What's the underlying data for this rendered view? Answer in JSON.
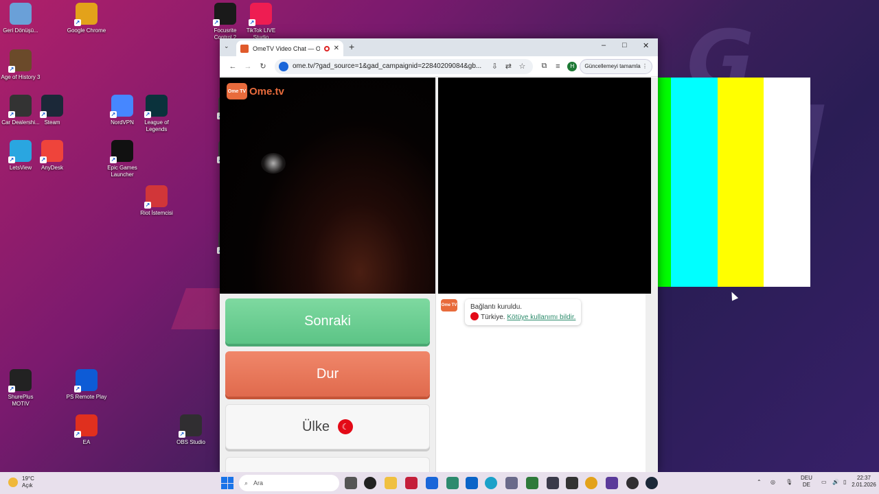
{
  "desktop": {
    "icons": [
      {
        "label": "Geri Dönüşü...",
        "icon": "recycle-bin-icon",
        "color": "#6aa0d8"
      },
      {
        "label": "Google Chrome",
        "icon": "chrome-icon",
        "color": "#e3a21a"
      },
      {
        "label": "Focusrite Control 2",
        "icon": "focusrite-icon",
        "color": "#1a1a1a"
      },
      {
        "label": "TikTok LIVE Studio",
        "icon": "tiktok-icon",
        "color": "#ee1d52"
      },
      {
        "label": "Age of History 3",
        "icon": "age-of-history-icon",
        "color": "#6b4a2a"
      },
      {
        "label": "Car Dealershi...",
        "icon": "car-dealership-icon",
        "color": "#333333"
      },
      {
        "label": "Steam",
        "icon": "steam-icon",
        "color": "#1b2838"
      },
      {
        "label": "NordVPN",
        "icon": "nordvpn-icon",
        "color": "#4687ff"
      },
      {
        "label": "League of Legends",
        "icon": "league-of-legends-icon",
        "color": "#0a323c"
      },
      {
        "label": "LetsView",
        "icon": "letsview-icon",
        "color": "#2aa6e0"
      },
      {
        "label": "AnyDesk",
        "icon": "anydesk-icon",
        "color": "#ef443b"
      },
      {
        "label": "Epic Games Launcher",
        "icon": "epic-games-icon",
        "color": "#111111"
      },
      {
        "label": "Riot İstemcisi",
        "icon": "riot-client-icon",
        "color": "#d13639"
      },
      {
        "label": "ShurePlus MOTIV",
        "icon": "shureplus-icon",
        "color": "#222222"
      },
      {
        "label": "PS Remote Play",
        "icon": "ps-remote-play-icon",
        "color": "#0d5bd6"
      },
      {
        "label": "EA",
        "icon": "ea-icon",
        "color": "#e0301e"
      },
      {
        "label": "OBS Studio",
        "icon": "obs-icon",
        "color": "#302e31"
      },
      {
        "label": "F",
        "icon": "partial-icon-1",
        "color": "#444444"
      },
      {
        "label": "REA",
        "icon": "partial-icon-2",
        "color": "#444444"
      },
      {
        "label": "Tea",
        "icon": "partial-icon-3",
        "color": "#444444"
      }
    ]
  },
  "browser": {
    "tab_title": "OmeTV Video Chat — Ome",
    "url": "ome.tv/?gad_source=1&gad_campaignid=22840209084&gb...",
    "profile_initial": "H",
    "update_label": "Güncellemeyi tamamla",
    "new_tab": "+",
    "controls": {
      "minimize": "–",
      "maximize": "□",
      "close": "✕"
    }
  },
  "page": {
    "logo_badge": "Ome TV",
    "logo_text": "Ome.tv",
    "buttons": {
      "next": "Sonraki",
      "stop": "Dur",
      "country": "Ülke"
    },
    "chat": {
      "badge": "Ome TV",
      "connected": "Bağlantı kuruldu.",
      "country": "Türkiye.",
      "report": "Kötüye kullanımı bildir."
    }
  },
  "color_bars": [
    "#000000",
    "#0000ff",
    "#ff0000",
    "#ff00ff",
    "#00ff00",
    "#00ffff",
    "#ffff00",
    "#ffffff"
  ],
  "taskbar": {
    "temperature": "19°C",
    "condition": "Açık",
    "search_placeholder": "Ara",
    "lang_1": "DEU",
    "lang_2": "DE",
    "time": "22:37",
    "date": "2.01.2026"
  }
}
